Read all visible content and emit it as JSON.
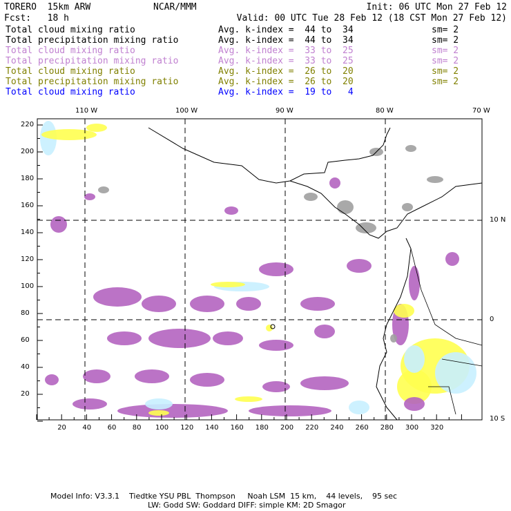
{
  "header": {
    "model": "TORERO  15km ARW",
    "org": "NCAR/MMM",
    "init": "Init: 06 UTC Mon 27 Feb 12",
    "fcst": "Fcst:   18 h",
    "valid": "Valid: 00 UTC Tue 28 Feb 12 (18 CST Mon 27 Feb 12)"
  },
  "legend": [
    {
      "field": "Total cloud mixing ratio",
      "kindex": "Avg. k-index =  44 to  34",
      "sm": "sm= 2",
      "color": "#000000"
    },
    {
      "field": "Total precipitation mixing ratio",
      "kindex": "Avg. k-index =  44 to  34",
      "sm": "sm= 2",
      "color": "#000000"
    },
    {
      "field": "Total cloud mixing ratio",
      "kindex": "Avg. k-index =  33 to  25",
      "sm": "sm= 2",
      "color": "#c080d0"
    },
    {
      "field": "Total precipitation mixing ratio",
      "kindex": "Avg. k-index =  33 to  25",
      "sm": "sm= 2",
      "color": "#c080d0"
    },
    {
      "field": "Total cloud mixing ratio",
      "kindex": "Avg. k-index =  26 to  20",
      "sm": "sm= 2",
      "color": "#808000"
    },
    {
      "field": "Total precipitation mixing ratio",
      "kindex": "Avg. k-index =  26 to  20",
      "sm": "sm= 2",
      "color": "#808000"
    },
    {
      "field": "Total cloud mixing ratio",
      "kindex": "Avg. k-index =  19 to   4",
      "sm": "",
      "color": "#0000ff"
    }
  ],
  "map": {
    "lon_labels": [
      "110 W",
      "100 W",
      "90 W",
      "80 W",
      "70 W"
    ],
    "lat_labels": [
      "10 N",
      "0",
      "10 S"
    ],
    "x_ticks": [
      "20",
      "40",
      "60",
      "80",
      "100",
      "120",
      "140",
      "160",
      "180",
      "200",
      "220",
      "240",
      "260",
      "280",
      "300",
      "320"
    ],
    "y_ticks": [
      "20",
      "40",
      "60",
      "80",
      "100",
      "120",
      "140",
      "160",
      "180",
      "200",
      "220"
    ],
    "colors": {
      "gray": "#a0a0a0",
      "purple": "#b464c0",
      "yellow": "#ffff50",
      "lightblue": "#c8f0ff"
    }
  },
  "footer": {
    "line1": "Model Info: V3.3.1    Tiedtke YSU PBL  Thompson     Noah LSM  15 km,    44 levels,    95 sec",
    "line2": "LW: Godd SW: Goddard DIFF: simple KM: 2D Smagor"
  }
}
